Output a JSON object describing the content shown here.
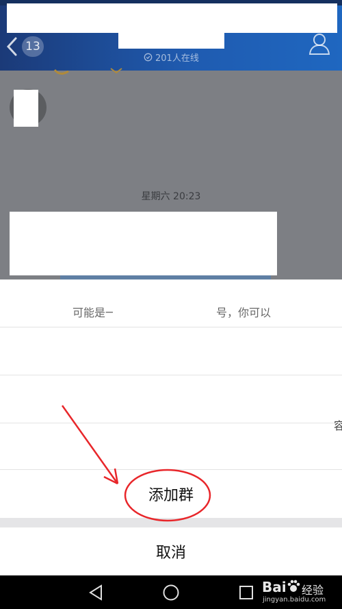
{
  "header": {
    "back_badge_count": "13",
    "online_text": "201人在线"
  },
  "chat": {
    "timestamp": "星期六 20:23"
  },
  "sheet": {
    "hint_left": "可能是一",
    "hint_right": "号，你可以",
    "primary_action": "添加群",
    "cancel_label": "取消",
    "edge_fragment": "容"
  },
  "watermark": {
    "brand": "Bai",
    "brand_cn": "经验",
    "url": "jingyan.baidu.com"
  },
  "colors": {
    "header_start": "#1b3a78",
    "header_end": "#1f67c0",
    "overlay": "#7d7f84",
    "annotation_red": "#e8262a"
  },
  "icons": [
    "chevron-left-icon",
    "clock-icon",
    "profile-icon",
    "back-triangle-icon",
    "home-circle-icon",
    "recents-square-icon",
    "baidu-paw-icon"
  ]
}
